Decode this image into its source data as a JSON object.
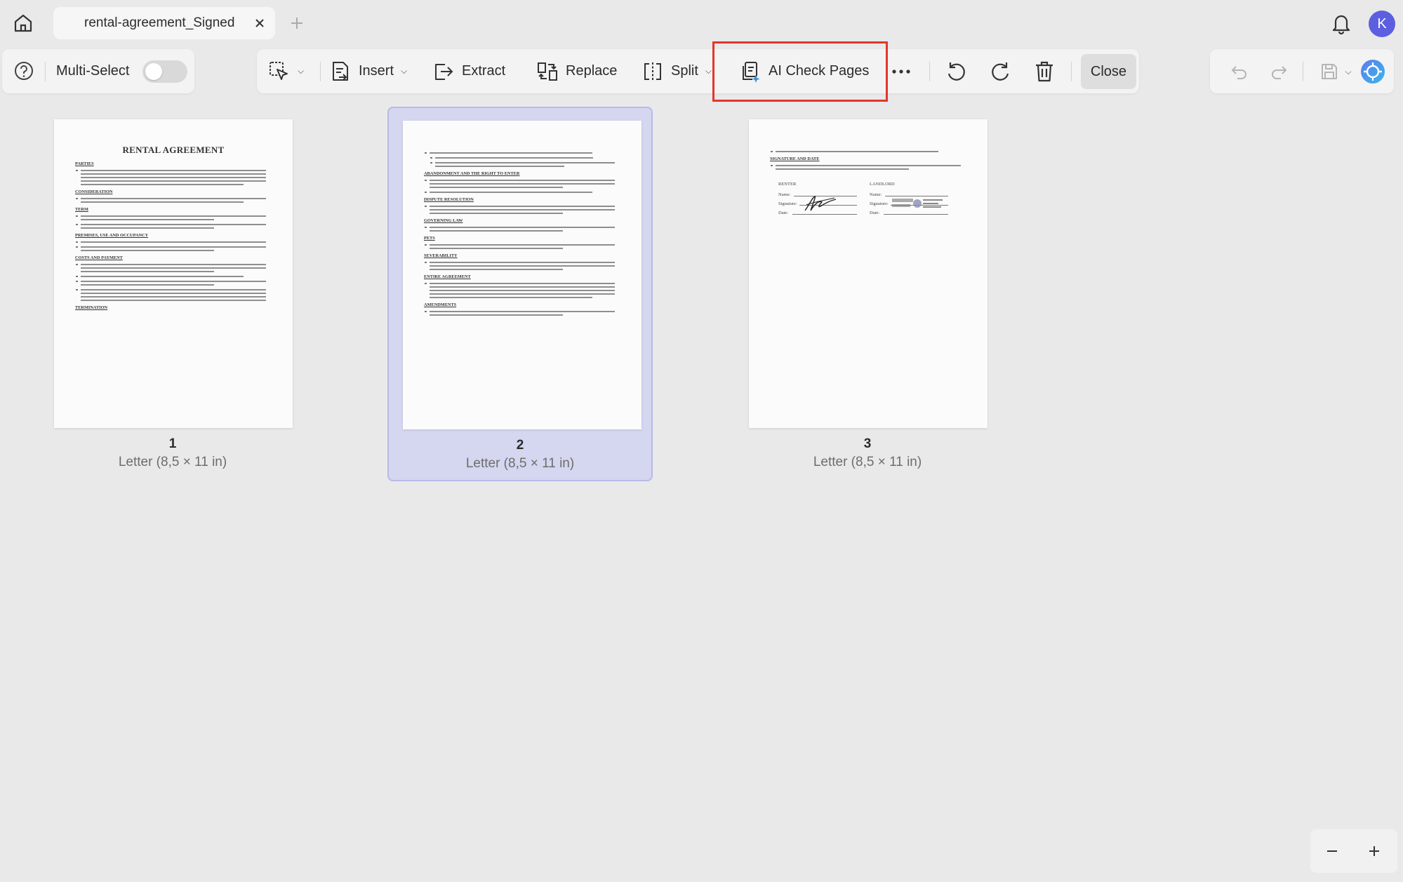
{
  "titlebar": {
    "tab_title": "rental-agreement_Signed",
    "avatar_letter": "K"
  },
  "toolbar": {
    "multi_select_label": "Multi-Select",
    "insert_label": "Insert",
    "extract_label": "Extract",
    "replace_label": "Replace",
    "split_label": "Split",
    "ai_check_label": "AI Check Pages",
    "close_label": "Close",
    "highlight_color": "#e3362b"
  },
  "pages": [
    {
      "number": "1",
      "size": "Letter (8,5 × 11 in)",
      "selected": false,
      "title": "RENTAL AGREEMENT",
      "sections": [
        "PARTIES",
        "CONSIDERATION",
        "TERM",
        "PREMISES, USE AND OCCUPANCY",
        "COSTS AND PAYMENT",
        "TERMINATION"
      ]
    },
    {
      "number": "2",
      "size": "Letter (8,5 × 11 in)",
      "selected": true,
      "sections": [
        "ABANDONMENT AND THE RIGHT TO ENTER",
        "DISPUTE RESOLUTION",
        "GOVERNING LAW",
        "PETS",
        "SEVERABILITY",
        "ENTIRE AGREEMENT",
        "AMENDMENTS"
      ]
    },
    {
      "number": "3",
      "size": "Letter (8,5 × 11 in)",
      "selected": false,
      "sections": [
        "SIGNATURE AND DATE"
      ],
      "renter_label": "RENTER",
      "landlord_label": "LANDLORD",
      "name_label": "Name:",
      "signature_label": "Signature:",
      "date_label": "Date:"
    }
  ],
  "colors": {
    "selected_page_bg": "#d5d6ef",
    "avatar": "#5b5fe0"
  }
}
